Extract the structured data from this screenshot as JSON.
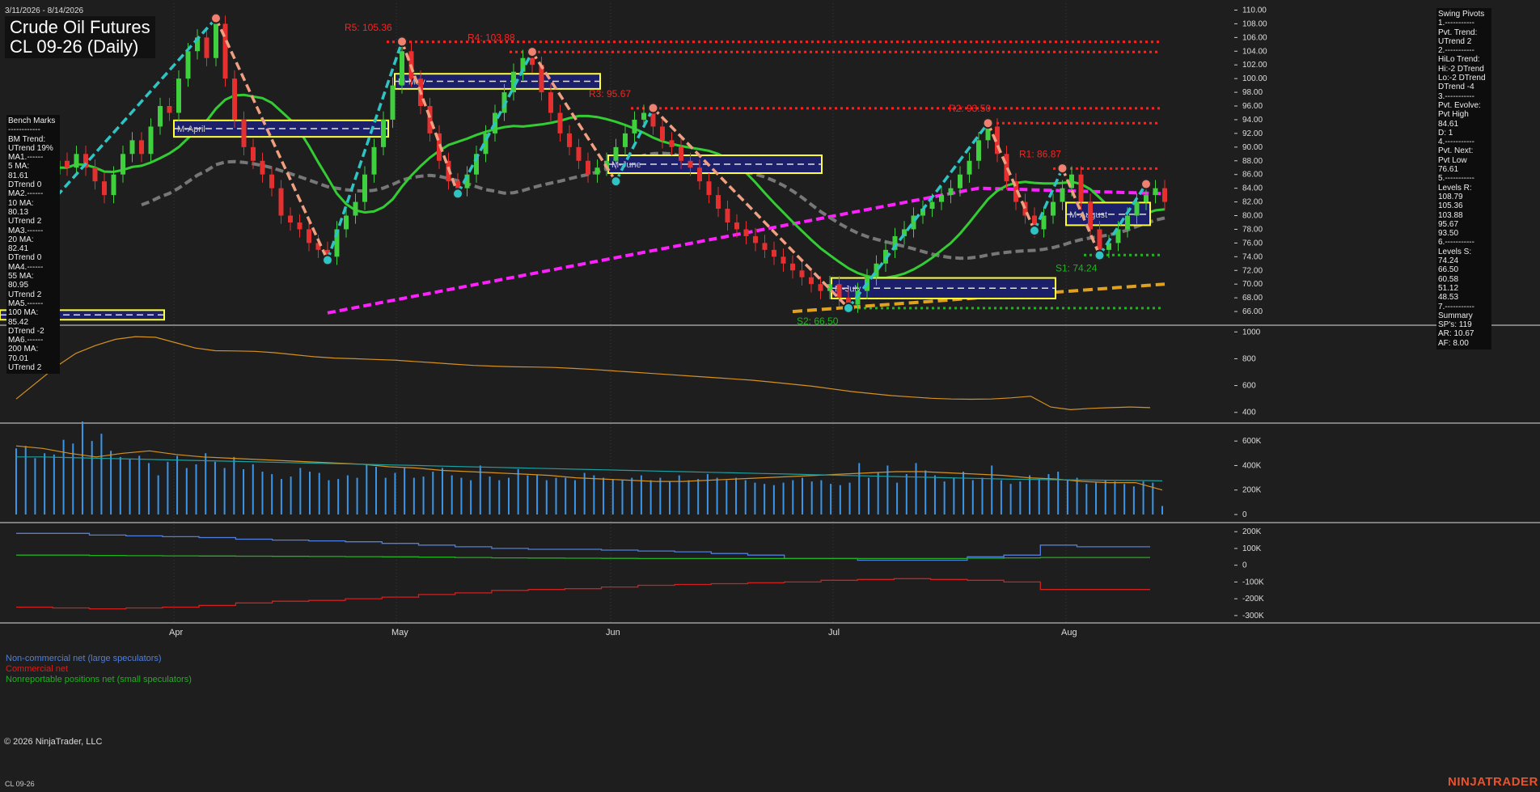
{
  "header": {
    "date_range": "3/11/2026 - 8/14/2026",
    "title": "Crude Oil Futures",
    "subtitle": "CL 09-26 (Daily)"
  },
  "benchmarks_text": "Bench Marks\n------------\nBM Trend:\nUTrend 19%\nMA1.------\n5 MA:\n81.61\nDTrend 0\nMA2.------\n10 MA:\n80.13\nUTrend 2\nMA3.------\n20 MA:\n82.41\nDTrend 0\nMA4.------\n55 MA:\n80.95\nUTrend 2\nMA5.------\n100 MA:\n85.42\nDTrend -2\nMA6.------\n200 MA:\n70.01\nUTrend 2",
  "swing_text": "Swing Pivots\n1.-----------\nPvt. Trend:\nUTrend 2\n2.-----------\nHiLo Trend:\nHi:-2 DTrend\nLo:-2 DTrend\nDTrend -4\n3.-----------\nPvt. Evolve:\nPvt High\n84.61\nD: 1\n4.-----------\nPvt. Next:\nPvt Low\n76.61\n5.-----------\nLevels R:\n108.79\n105.36\n103.88\n95.67\n93.50\n6.-----------\nLevels S:\n74.24\n66.50\n60.58\n51.12\n48.53\n7.-----------\nSummary\nSP's: 119\nAR: 10.67\nAF: 8.00",
  "footer": {
    "copyright": "© 2026 NinjaTrader, LLC",
    "symbol": "CL 09-26",
    "brand": "NINJATRADER"
  },
  "cot_legend": {
    "noncommercial": "Non-commercial net (large speculators)",
    "commercial": "Commercial net",
    "nonreportable": "Nonreportable positions net (small speculators)"
  },
  "colors": {
    "background": "#1e1e1e",
    "up_candle": "#3fcf3f",
    "down_candle": "#e63030",
    "resistance": "#ff2020",
    "support": "#1eb51e",
    "ma_green": "#33cc33",
    "ma_gray": "#777777",
    "ma_magenta": "#ff20ff",
    "ma_gold": "#e0a020",
    "swing_up": "#2ec4c4",
    "swing_down": "#f0a080",
    "volume": "#3a95e8",
    "noncommercial": "#4f7fdf",
    "commercial": "#d02020",
    "nonreportable": "#20b020"
  },
  "chart_data": [
    {
      "type": "candlestick",
      "title": "Crude Oil Futures CL 09-26 (Daily)",
      "x_labels": [
        "Apr",
        "May",
        "Jun",
        "Jul",
        "Aug"
      ],
      "y_ticks": [
        66,
        68,
        70,
        72,
        74,
        76,
        78,
        80,
        82,
        84,
        86,
        88,
        90,
        92,
        94,
        96,
        98,
        100,
        102,
        104,
        106,
        108,
        110
      ],
      "y_tick_labels": [
        "66.00",
        "68.00",
        "70.00",
        "72.00",
        "74.00",
        "76.00",
        "78.00",
        "80.00",
        "82.00",
        "84.00",
        "86.00",
        "88.00",
        "90.00",
        "92.00",
        "94.00",
        "96.00",
        "98.00",
        "100.00",
        "102.00",
        "104.00",
        "106.00",
        "108.00",
        "110.00"
      ],
      "ylim": [
        64,
        111
      ],
      "resistance_levels": [
        {
          "label": "R5: 105.36",
          "value": 105.36
        },
        {
          "label": "R4: 103.88",
          "value": 103.88
        },
        {
          "label": "R3: 95.67",
          "value": 95.67
        },
        {
          "label": "R2: 93.50",
          "value": 93.5
        },
        {
          "label": "R1: 86.87",
          "value": 86.87
        }
      ],
      "support_levels": [
        {
          "label": "S1: 74.24",
          "value": 74.24
        },
        {
          "label": "S2: 66.50",
          "value": 66.5
        }
      ],
      "month_boxes": [
        {
          "label": "M-April",
          "low": 91.5,
          "high": 93.9,
          "mid": 92.7
        },
        {
          "label": "M-May",
          "low": 98.5,
          "high": 100.7,
          "mid": 99.6
        },
        {
          "label": "M-June",
          "low": 86.2,
          "high": 88.8,
          "mid": 87.5
        },
        {
          "label": "M-July",
          "low": 67.9,
          "high": 70.9,
          "mid": 69.4
        },
        {
          "label": "M-August",
          "low": 78.6,
          "high": 81.9,
          "mid": 80.2
        },
        {
          "label": "",
          "low": 64.8,
          "high": 66.2,
          "mid": 65.5
        }
      ],
      "swing_pivots": [
        {
          "date_index": 0,
          "value": 81.5
        },
        {
          "date_index": 18,
          "value": 108.8
        },
        {
          "date_index": 30,
          "value": 73.5
        },
        {
          "date_index": 38,
          "value": 105.4
        },
        {
          "date_index": 44,
          "value": 83.2
        },
        {
          "date_index": 52,
          "value": 103.9
        },
        {
          "date_index": 61,
          "value": 85.0
        },
        {
          "date_index": 65,
          "value": 95.7
        },
        {
          "date_index": 86,
          "value": 66.5
        },
        {
          "date_index": 101,
          "value": 93.5
        },
        {
          "date_index": 106,
          "value": 77.8
        },
        {
          "date_index": 109,
          "value": 86.9
        },
        {
          "date_index": 113,
          "value": 74.2
        },
        {
          "date_index": 118,
          "value": 84.6
        }
      ],
      "closes_approx": [
        86,
        88,
        87,
        89,
        87,
        85,
        83,
        86,
        89,
        91,
        89,
        93,
        96,
        95,
        100,
        104,
        106,
        103,
        108,
        100,
        94,
        90,
        88,
        86,
        84,
        80,
        79,
        78,
        76,
        75,
        74,
        78,
        80,
        82,
        86,
        90,
        94,
        99,
        104,
        100,
        96,
        92,
        88,
        85,
        84,
        86,
        89,
        92,
        95,
        98,
        101,
        103,
        102,
        98,
        95,
        92,
        90,
        88,
        86,
        87,
        88,
        90,
        92,
        94,
        95,
        93,
        91,
        90,
        88,
        87,
        85,
        83,
        81,
        79,
        78,
        77,
        76,
        75,
        74,
        73,
        72,
        71,
        70,
        69,
        70,
        68,
        67,
        69,
        71,
        73,
        75,
        77,
        78,
        80,
        81,
        82,
        83,
        84,
        86,
        88,
        91,
        93,
        89,
        85,
        82,
        80,
        78,
        80,
        82,
        84,
        86,
        82,
        78,
        75,
        76,
        78,
        80,
        82,
        83,
        84,
        82
      ]
    },
    {
      "type": "line",
      "title": "",
      "y_tick_labels": [
        "1000",
        "800",
        "600",
        "400"
      ],
      "ylim": [
        320,
        1050
      ],
      "values": [
        500,
        620,
        740,
        840,
        900,
        945,
        965,
        960,
        920,
        880,
        860,
        858,
        855,
        845,
        830,
        815,
        805,
        800,
        795,
        790,
        780,
        770,
        760,
        750,
        745,
        740,
        738,
        735,
        728,
        720,
        710,
        700,
        690,
        680,
        670,
        660,
        650,
        640,
        625,
        610,
        595,
        575,
        555,
        540,
        525,
        515,
        505,
        500,
        498,
        500,
        508,
        520,
        440,
        420,
        430,
        435,
        440,
        435
      ]
    },
    {
      "type": "bar",
      "title": "",
      "y_tick_labels": [
        "600K",
        "400K",
        "200K",
        "0"
      ],
      "ylim": [
        0,
        720000
      ],
      "values": [
        540000,
        560000,
        460000,
        500000,
        490000,
        610000,
        580000,
        760000,
        600000,
        660000,
        520000,
        470000,
        450000,
        480000,
        420000,
        320000,
        430000,
        480000,
        380000,
        410000,
        500000,
        430000,
        380000,
        470000,
        370000,
        410000,
        350000,
        330000,
        290000,
        310000,
        380000,
        350000,
        340000,
        280000,
        290000,
        320000,
        300000,
        410000,
        390000,
        300000,
        340000,
        380000,
        300000,
        310000,
        350000,
        380000,
        320000,
        300000,
        280000,
        400000,
        310000,
        280000,
        300000,
        370000,
        320000,
        320000,
        280000,
        300000,
        300000,
        280000,
        340000,
        320000,
        300000,
        290000,
        280000,
        300000,
        320000,
        280000,
        300000,
        270000,
        320000,
        280000,
        290000,
        330000,
        300000,
        280000,
        300000,
        280000,
        260000,
        250000,
        240000,
        260000,
        280000,
        300000,
        270000,
        280000,
        250000,
        240000,
        260000,
        420000,
        300000,
        340000,
        400000,
        260000,
        330000,
        420000,
        360000,
        320000,
        270000,
        300000,
        350000,
        280000,
        300000,
        400000,
        280000,
        250000,
        270000,
        320000,
        290000,
        330000,
        350000,
        280000,
        300000,
        250000,
        260000,
        280000,
        270000,
        250000,
        230000,
        270000,
        260000,
        70000
      ],
      "series_lines": [
        {
          "name": "",
          "values": [
            560000,
            540000,
            500000,
            470000,
            500000,
            520000,
            490000,
            470000,
            460000,
            450000,
            440000,
            430000,
            420000,
            410000,
            390000,
            380000,
            360000,
            350000,
            340000,
            330000,
            320000,
            300000,
            290000,
            280000,
            270000,
            270000,
            280000,
            290000,
            300000,
            310000,
            320000,
            330000,
            340000,
            350000,
            350000,
            340000,
            330000,
            320000,
            300000,
            290000,
            270000,
            260000,
            260000,
            200000
          ]
        },
        {
          "name": "",
          "values": [
            470000,
            470000,
            465000,
            460000,
            455000,
            450000,
            445000,
            440000,
            435000,
            430000,
            425000,
            420000,
            415000,
            410000,
            405000,
            400000,
            395000,
            390000,
            385000,
            380000,
            375000,
            370000,
            365000,
            360000,
            355000,
            350000,
            345000,
            340000,
            335000,
            330000,
            325000,
            320000,
            315000,
            310000,
            305000,
            300000,
            295000,
            290000,
            287000,
            284000,
            282000,
            280000,
            278000,
            275000
          ]
        }
      ]
    },
    {
      "type": "line",
      "title": "",
      "y_tick_labels": [
        "200K",
        "100K",
        "0",
        "-100K",
        "-200K",
        "-300K"
      ],
      "ylim": [
        -320000,
        230000
      ],
      "series": [
        {
          "name": "Non-commercial net (large speculators)",
          "values": [
            190000,
            190000,
            180000,
            175000,
            170000,
            165000,
            155000,
            150000,
            145000,
            140000,
            130000,
            120000,
            110000,
            100000,
            95000,
            95000,
            90000,
            85000,
            80000,
            70000,
            60000,
            40000,
            40000,
            30000,
            30000,
            30000,
            50000,
            60000,
            120000,
            110000,
            110000,
            110000
          ]
        },
        {
          "name": "Commercial net",
          "values": [
            -250000,
            -255000,
            -260000,
            -255000,
            -250000,
            -240000,
            -225000,
            -215000,
            -210000,
            -200000,
            -190000,
            -175000,
            -165000,
            -150000,
            -145000,
            -140000,
            -130000,
            -120000,
            -115000,
            -110000,
            -105000,
            -100000,
            -90000,
            -85000,
            -80000,
            -85000,
            -90000,
            -100000,
            -145000,
            -145000,
            -145000,
            -145000
          ]
        },
        {
          "name": "Nonreportable positions net (small speculators)",
          "values": [
            60000,
            60000,
            58000,
            57000,
            56000,
            55000,
            54000,
            53000,
            52000,
            51000,
            50000,
            48000,
            46000,
            44000,
            43000,
            42000,
            41000,
            40000,
            40000,
            40000,
            40000,
            40000,
            40000,
            40000,
            40000,
            40000,
            42000,
            44000,
            46000,
            46000,
            46000,
            46000
          ]
        }
      ]
    }
  ]
}
